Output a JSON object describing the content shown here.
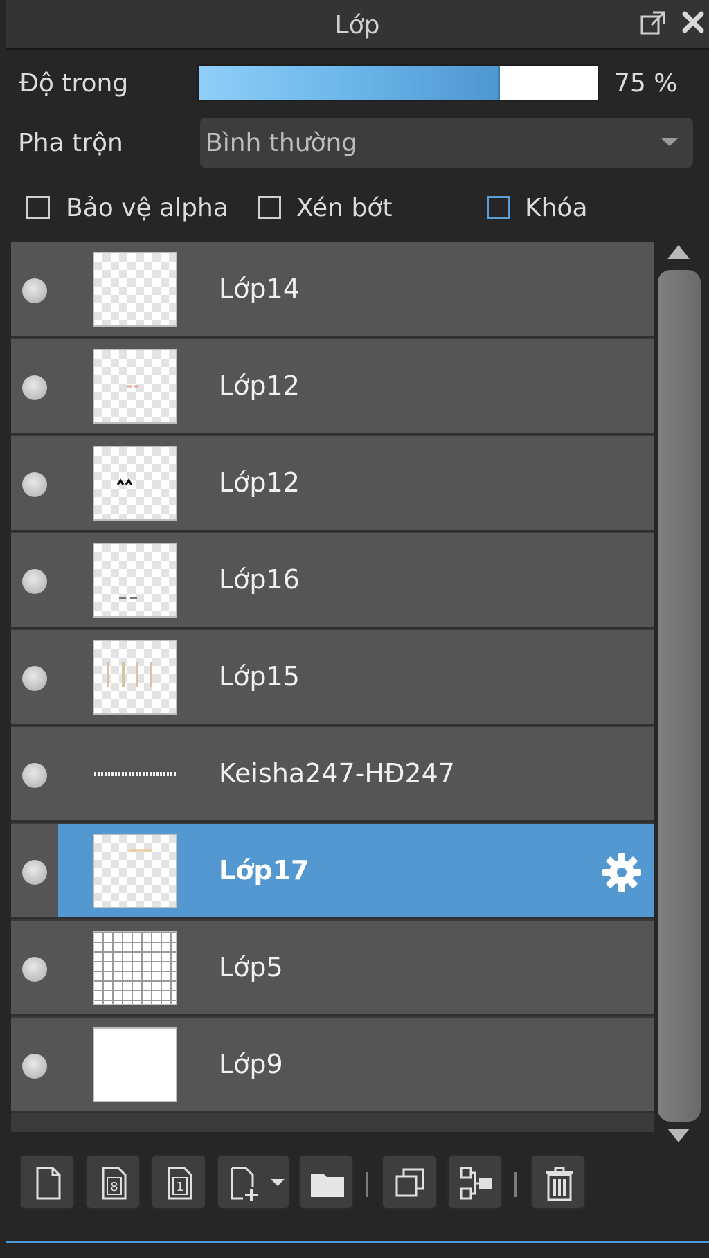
{
  "panel": {
    "title": "Lớp"
  },
  "opacity": {
    "label": "Độ trong",
    "value_text": "75 %",
    "fraction": 0.75
  },
  "blend": {
    "label": "Pha trộn",
    "value": "Bình thường"
  },
  "options": {
    "protect_alpha": "Bảo vệ alpha",
    "clip": "Xén bớt",
    "lock": "Khóa"
  },
  "layers": [
    {
      "name": "Lớp14",
      "thumb": "checker"
    },
    {
      "name": "Lớp12",
      "thumb": "checker"
    },
    {
      "name": "Lớp12",
      "thumb": "checker"
    },
    {
      "name": "Lớp16",
      "thumb": "checker"
    },
    {
      "name": "Lớp15",
      "thumb": "checker"
    },
    {
      "name": "Keisha247-HĐ247",
      "thumb": "text"
    },
    {
      "name": "Lớp17",
      "thumb": "checker",
      "selected": true
    },
    {
      "name": "Lớp5",
      "thumb": "grid"
    },
    {
      "name": "Lớp9",
      "thumb": "white"
    }
  ],
  "colors": {
    "selection": "#5398d1",
    "accent": "#4e9ad8"
  }
}
